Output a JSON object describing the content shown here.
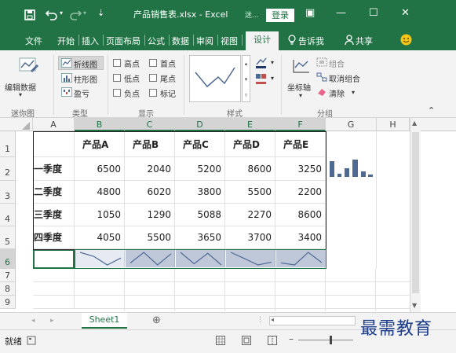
{
  "titlebar": {
    "save_icon": "save-icon",
    "undo_icon": "undo-icon",
    "redo_icon": "redo-icon",
    "customize": "⇣",
    "title": "产品销售表.xlsx - Excel",
    "context_tab": "迷...",
    "login": "登录",
    "ribbon_display": "▣",
    "minimize": "—",
    "maximize": "☐",
    "close": "✕"
  },
  "tabs": [
    "文件",
    "开始",
    "插入",
    "页面布局",
    "公式",
    "数据",
    "审阅",
    "视图",
    "设计"
  ],
  "tell_me": "告诉我",
  "share": "共享",
  "ribbon": {
    "edit_data": "编辑数据",
    "group_sparkline": "迷你图",
    "line": "折线图",
    "column": "柱形图",
    "winloss": "盈亏",
    "group_type": "类型",
    "high_point": "高点",
    "low_point": "低点",
    "negative_point": "负点",
    "first_point": "首点",
    "last_point": "尾点",
    "markers": "标记",
    "group_show": "显示",
    "group_style": "样式",
    "axis": "坐标轴",
    "group_label": "组合",
    "ungroup": "取消组合",
    "clear": "清除",
    "group_group": "分组"
  },
  "columns": [
    "A",
    "B",
    "C",
    "D",
    "E",
    "F",
    "G",
    "H"
  ],
  "rows": [
    "1",
    "2",
    "3",
    "4",
    "5",
    "6",
    "7",
    "8",
    "9"
  ],
  "table": {
    "headers": [
      "",
      "产品A",
      "产品B",
      "产品C",
      "产品D",
      "产品E"
    ],
    "body": [
      [
        "一季度",
        "6500",
        "2040",
        "5200",
        "8600",
        "3250"
      ],
      [
        "二季度",
        "4800",
        "6020",
        "3800",
        "5500",
        "2200"
      ],
      [
        "三季度",
        "1050",
        "1290",
        "5088",
        "2270",
        "8600"
      ],
      [
        "四季度",
        "4050",
        "5500",
        "3650",
        "3700",
        "3400"
      ]
    ]
  },
  "sheet": {
    "tab": "Sheet1",
    "add": "⊕"
  },
  "status": {
    "ready": "就绪"
  },
  "watermark": "最需教育",
  "colors": {
    "excel_green": "#217346",
    "sparkline": "#4e6a93",
    "selection": "#bfc8d9"
  }
}
